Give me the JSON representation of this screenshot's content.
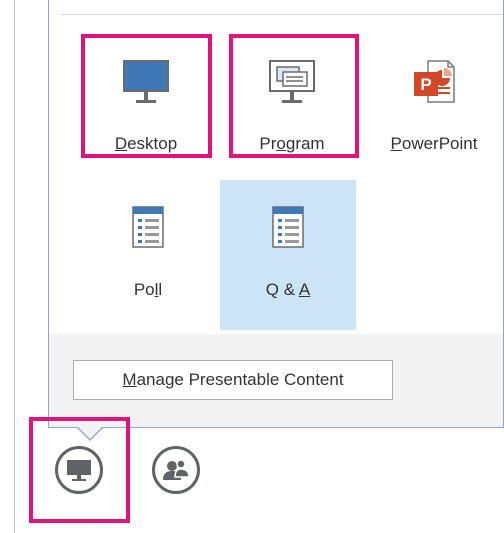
{
  "tiles": {
    "desktop": {
      "pre": "",
      "ul": "D",
      "post": "esktop"
    },
    "program": {
      "pre": "Pr",
      "ul": "o",
      "post": "gram"
    },
    "powerpoint": {
      "pre": "",
      "ul": "P",
      "post": "owerPoint"
    },
    "poll": {
      "pre": "Po",
      "ul": "l",
      "post": "l"
    },
    "qa": {
      "pre": "Q & ",
      "ul": "A",
      "post": ""
    }
  },
  "manage_button": {
    "pre": "",
    "ul": "M",
    "post": "anage Presentable Content"
  },
  "bottom_bar": {
    "present_icon": "monitor-icon",
    "participants_icon": "people-icon"
  },
  "colors": {
    "highlight": "#e0157c",
    "selected_tile": "#cde4f7",
    "powerpoint": "#d24726"
  }
}
